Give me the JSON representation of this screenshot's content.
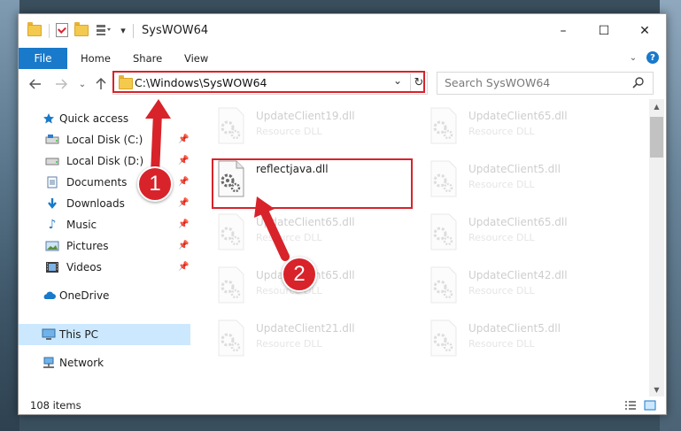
{
  "window": {
    "title": "SysWOW64",
    "controls": {
      "minimize": "–",
      "maximize": "☐",
      "close": "✕"
    }
  },
  "ribbon": {
    "tabs": [
      {
        "label": "File",
        "active": true
      },
      {
        "label": "Home"
      },
      {
        "label": "Share"
      },
      {
        "label": "View"
      }
    ]
  },
  "navigation": {
    "address": "C:\\Windows\\SysWOW64",
    "search_placeholder": "Search SysWOW64"
  },
  "sidebar": {
    "items": [
      {
        "label": "Quick access",
        "icon": "star-icon",
        "pinned": false
      },
      {
        "label": "Local Disk (C:)",
        "icon": "drive-icon",
        "pinned": true
      },
      {
        "label": "Local Disk (D:)",
        "icon": "drive-icon",
        "pinned": true
      },
      {
        "label": "Documents",
        "icon": "documents-icon",
        "pinned": true
      },
      {
        "label": "Downloads",
        "icon": "download-icon",
        "pinned": true
      },
      {
        "label": "Music",
        "icon": "music-icon",
        "pinned": true
      },
      {
        "label": "Pictures",
        "icon": "pictures-icon",
        "pinned": true
      },
      {
        "label": "Videos",
        "icon": "videos-icon",
        "pinned": true
      },
      {
        "label": "OneDrive",
        "icon": "cloud-icon",
        "pinned": false
      },
      {
        "label": "This PC",
        "icon": "computer-icon",
        "selected": true
      },
      {
        "label": "Network",
        "icon": "network-icon",
        "pinned": false
      }
    ]
  },
  "files": [
    {
      "name": "UpdateClient19.dll",
      "type": "Resource DLL",
      "faded": true
    },
    {
      "name": "UpdateClient65.dll",
      "type": "Resource DLL",
      "faded": true
    },
    {
      "name": "reflectjava.dll",
      "type": "",
      "faded": false,
      "highlighted": true
    },
    {
      "name": "UpdateClient5.dll",
      "type": "Resource DLL",
      "faded": true
    },
    {
      "name": "UpdateClient65.dll",
      "type": "Resource DLL",
      "faded": true
    },
    {
      "name": "UpdateClient65.dll",
      "type": "Resource DLL",
      "faded": true
    },
    {
      "name": "UpdateClient65.dll",
      "type": "Resource DLL",
      "faded": true
    },
    {
      "name": "UpdateClient42.dll",
      "type": "Resource DLL",
      "faded": true
    },
    {
      "name": "UpdateClient21.dll",
      "type": "Resource DLL",
      "faded": true
    },
    {
      "name": "UpdateClient5.dll",
      "type": "Resource DLL",
      "faded": true
    }
  ],
  "status": {
    "item_count": "108 items"
  },
  "annotations": {
    "step1": "1",
    "step2": "2",
    "highlight_color": "#d8232a"
  },
  "colors": {
    "accent": "#1979ca",
    "selection": "#cce8ff"
  }
}
